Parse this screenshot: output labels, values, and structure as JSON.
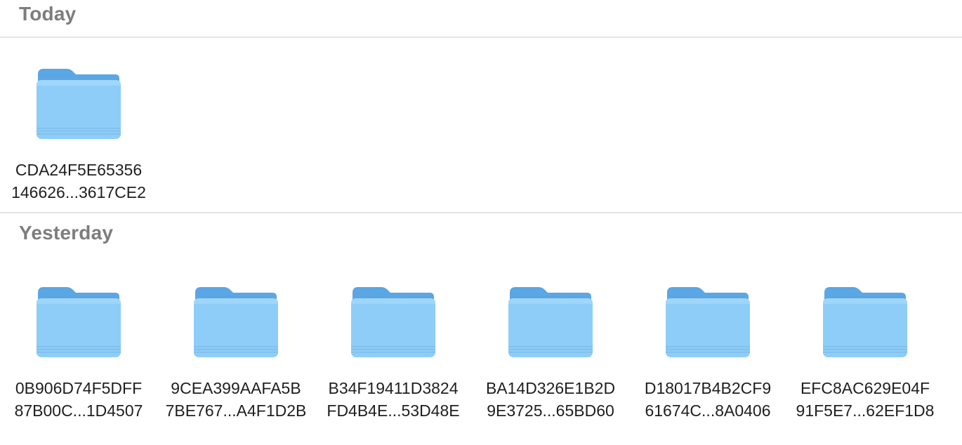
{
  "sections": [
    {
      "title": "Today",
      "items": [
        {
          "line1": "CDA24F5E65356",
          "line2": "146626...3617CE2",
          "icon": "folder-icon"
        }
      ]
    },
    {
      "title": "Yesterday",
      "items": [
        {
          "line1": "0B906D74F5DFF",
          "line2": "87B00C...1D4507",
          "icon": "folder-icon"
        },
        {
          "line1": "9CEA399AAFA5B",
          "line2": "7BE767...A4F1D2B",
          "icon": "folder-icon"
        },
        {
          "line1": "B34F19411D3824",
          "line2": "FD4B4E...53D48E",
          "icon": "folder-icon"
        },
        {
          "line1": "BA14D326E1B2D",
          "line2": "9E3725...65BD60",
          "icon": "folder-icon"
        },
        {
          "line1": "D18017B4B2CF9",
          "line2": "61674C...8A0406",
          "icon": "folder-icon"
        },
        {
          "line1": "EFC8AC629E04F",
          "line2": "91F5E7...62EF1D8",
          "icon": "folder-icon"
        }
      ]
    }
  ],
  "colors": {
    "folder_front": "#8ecdf8",
    "folder_back": "#5ba6e4",
    "header_text": "#7d7d7d",
    "divider": "#e3e3e3"
  }
}
